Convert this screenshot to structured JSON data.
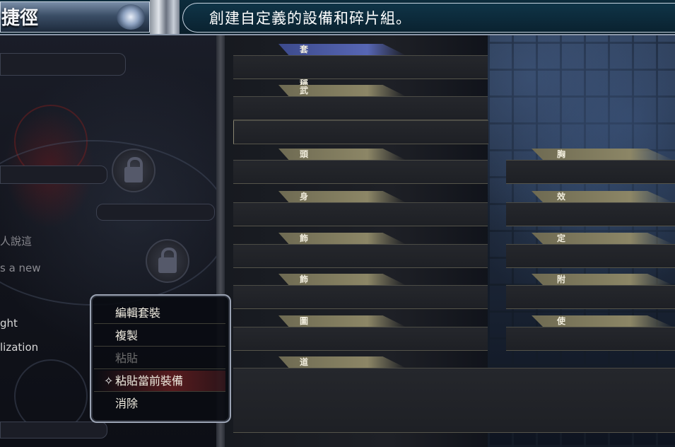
{
  "header": {
    "title": "捷徑",
    "description": "創建自定義的設備和碎片組。"
  },
  "left_panel": {
    "text_1": "人說這",
    "text_2": "s a new",
    "text_3": "ght",
    "text_4": "lization"
  },
  "slots": {
    "set_name": "套裝名稱",
    "weapon": "武器",
    "head": "頭部",
    "chest": "胸甲",
    "body": "身體",
    "effect": "效果",
    "accessory1": "飾品I",
    "orientation": "定向",
    "accessory2": "飾品II",
    "enchant": "附魔",
    "headwear": "圖巾",
    "familiar": "使魔",
    "item": "道具"
  },
  "context_menu": {
    "items": [
      {
        "label": "編輯套裝"
      },
      {
        "label": "複製"
      },
      {
        "label": "粘貼"
      },
      {
        "label": "粘貼當前裝備"
      },
      {
        "label": "消除"
      }
    ]
  },
  "colors": {
    "header_bg": "#0d2c3c",
    "slot_tab": "#8c8666",
    "slot_tab_active": "#5766b4",
    "menu_highlight": "#962828"
  }
}
